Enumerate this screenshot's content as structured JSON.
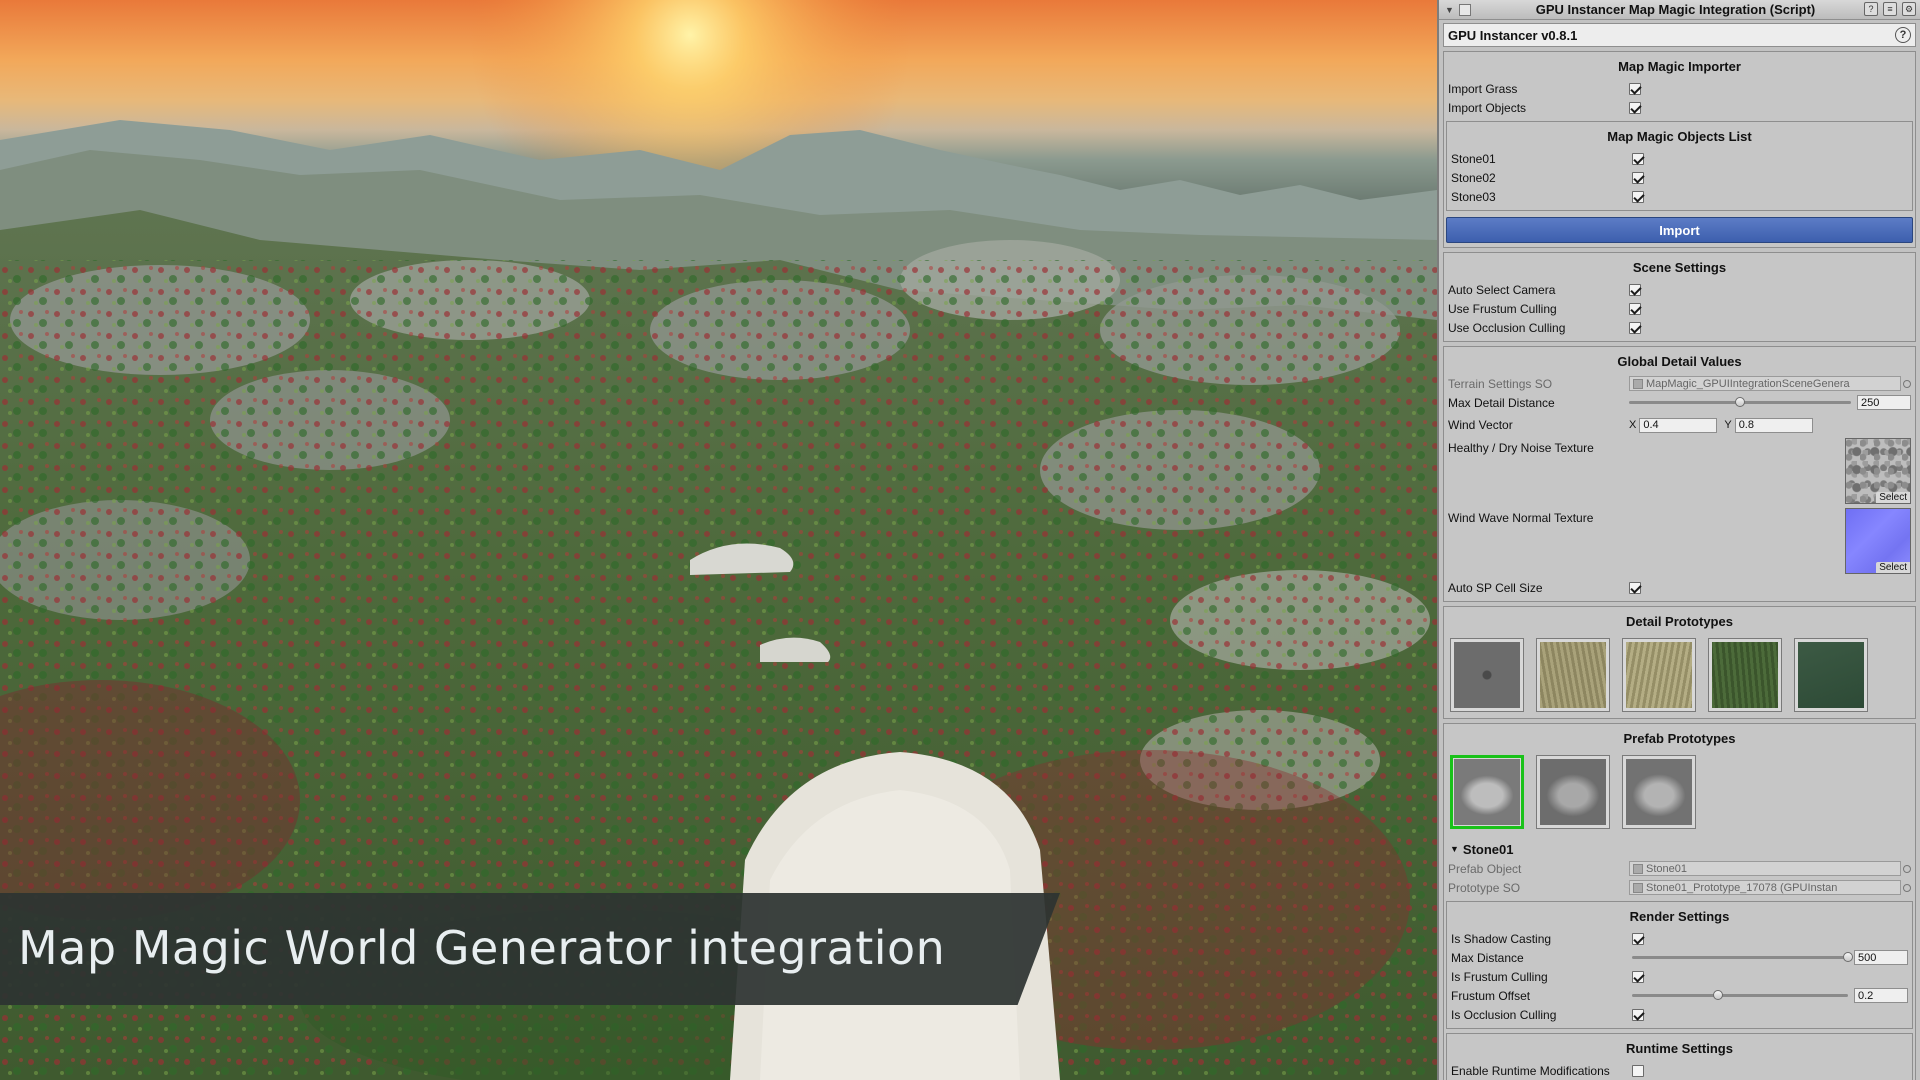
{
  "caption": "Map Magic World Generator integration",
  "inspector": {
    "title": "GPU Instancer Map Magic Integration (Script)",
    "version": "GPU Instancer v0.8.1",
    "importer": {
      "title": "Map Magic Importer",
      "rows": [
        {
          "label": "Import Grass",
          "checked": true
        },
        {
          "label": "Import Objects",
          "checked": true
        }
      ],
      "objects_list": {
        "title": "Map Magic Objects List",
        "items": [
          {
            "label": "Stone01",
            "checked": true
          },
          {
            "label": "Stone02",
            "checked": true
          },
          {
            "label": "Stone03",
            "checked": true
          }
        ]
      },
      "import_label": "Import"
    },
    "scene_settings": {
      "title": "Scene Settings",
      "rows": [
        {
          "label": "Auto Select Camera",
          "checked": true
        },
        {
          "label": "Use Frustum Culling",
          "checked": true
        },
        {
          "label": "Use Occlusion Culling",
          "checked": true
        }
      ]
    },
    "global_detail": {
      "title": "Global Detail Values",
      "terrain_settings_label": "Terrain Settings SO",
      "terrain_settings_value": "MapMagic_GPUIIntegrationSceneGenera",
      "max_detail_label": "Max Detail Distance",
      "max_detail_value": "250",
      "max_detail_fraction": 0.5,
      "wind_label": "Wind Vector",
      "wind_x_label": "X",
      "wind_x": "0.4",
      "wind_y_label": "Y",
      "wind_y": "0.8",
      "noise_label": "Healthy / Dry Noise Texture",
      "wave_label": "Wind Wave Normal Texture",
      "select_label": "Select",
      "auto_sp_label": "Auto SP Cell Size",
      "auto_sp_checked": true
    },
    "detail_prototypes": {
      "title": "Detail Prototypes",
      "items": [
        "detail-prototype-1",
        "detail-prototype-2",
        "detail-prototype-3",
        "detail-prototype-4",
        "detail-prototype-5"
      ]
    },
    "prefab_prototypes": {
      "title": "Prefab Prototypes",
      "items": [
        "prefab-prototype-1",
        "prefab-prototype-2",
        "prefab-prototype-3"
      ],
      "selected_index": 0
    },
    "stone01": {
      "name": "Stone01",
      "prefab_object_label": "Prefab Object",
      "prefab_object_value": "Stone01",
      "prototype_so_label": "Prototype SO",
      "prototype_so_value": "Stone01_Prototype_17078 (GPUInstan",
      "render_settings": {
        "title": "Render Settings",
        "shadow_label": "Is Shadow Casting",
        "shadow_checked": true,
        "max_distance_label": "Max Distance",
        "max_distance_value": "500",
        "max_distance_fraction": 1.0,
        "frustum_label": "Is Frustum Culling",
        "frustum_checked": true,
        "frustum_offset_label": "Frustum Offset",
        "frustum_offset_value": "0.2",
        "frustum_offset_fraction": 0.4,
        "occlusion_label": "Is Occlusion Culling",
        "occlusion_checked": true
      },
      "runtime_settings": {
        "title": "Runtime Settings",
        "enable_label": "Enable Runtime Modifications",
        "enable_checked": false
      }
    }
  }
}
